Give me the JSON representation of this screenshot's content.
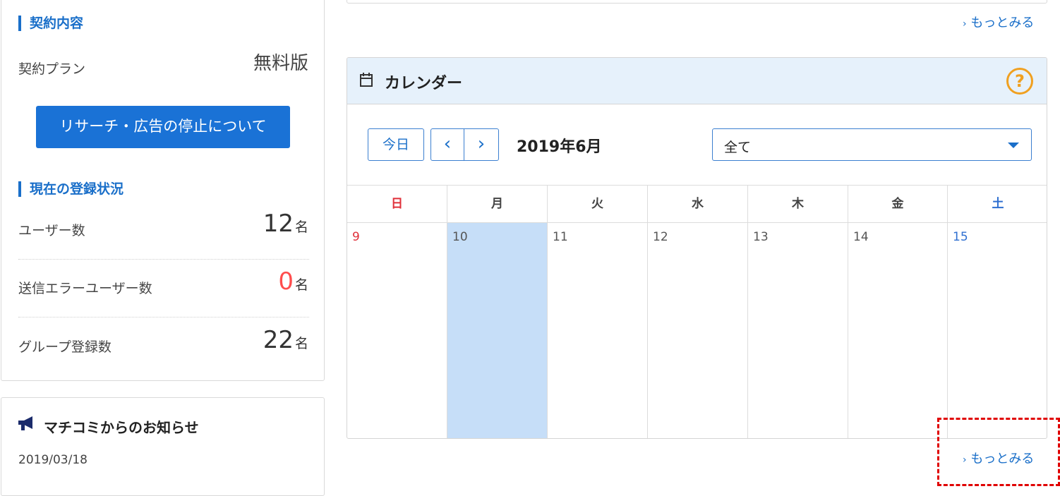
{
  "contract": {
    "heading": "契約内容",
    "plan_label": "契約プラン",
    "plan_value": "無料版",
    "research_button": "リサーチ・広告の停止について"
  },
  "registration": {
    "heading": "現在の登録状況",
    "rows": [
      {
        "label": "ユーザー数",
        "value": "12",
        "unit": "名",
        "color": "#333333"
      },
      {
        "label": "送信エラーユーザー数",
        "value": "0",
        "unit": "名",
        "color": "#ff4d4d"
      },
      {
        "label": "グループ登録数",
        "value": "22",
        "unit": "名",
        "color": "#333333"
      }
    ]
  },
  "news": {
    "heading": "マチコミからのお知らせ",
    "date": "2019/03/18"
  },
  "more_top": "もっとみる",
  "calendar": {
    "title": "カレンダー",
    "help": "?",
    "today_button": "今日",
    "prev": "‹",
    "next": "›",
    "month": "2019年6月",
    "filter_value": "全て",
    "weekdays": [
      "日",
      "月",
      "火",
      "水",
      "木",
      "金",
      "土"
    ],
    "dates": [
      "9",
      "10",
      "11",
      "12",
      "13",
      "14",
      "15"
    ],
    "more": "もっとみる"
  }
}
